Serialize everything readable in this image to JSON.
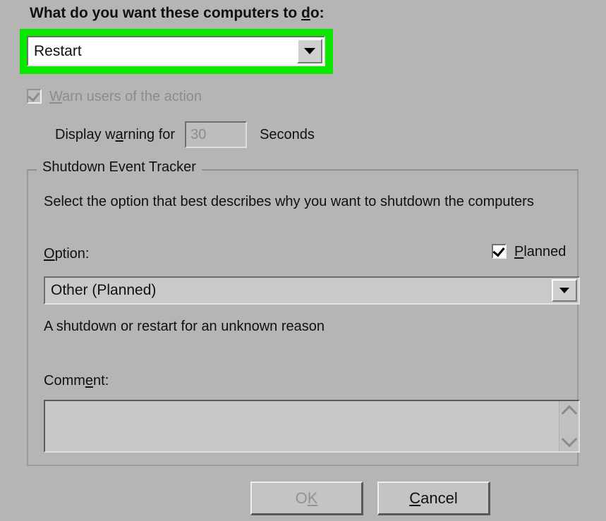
{
  "dialog": {
    "background_color": "#b5b5b5",
    "question_label_prefix": "What do you want these computers to ",
    "question_label_accel": "d",
    "question_label_suffix": "o:"
  },
  "action": {
    "highlight_color": "#0be800",
    "selected_value": "Restart",
    "dropdown_icon": "chevron-down-icon"
  },
  "warn": {
    "checked": true,
    "enabled": false,
    "label_accel": "W",
    "label_rest": "arn users of the action",
    "display_warning_prefix": "Display w",
    "display_warning_accel": "a",
    "display_warning_suffix": "rning for",
    "seconds_value": "30",
    "seconds_label": "Seconds"
  },
  "tracker": {
    "legend": "Shutdown Event Tracker",
    "description": "Select the option that best describes why you want to shutdown the computers",
    "option_label_accel": "O",
    "option_label_rest": "ption:",
    "planned_label_accel": "P",
    "planned_label_rest": "lanned",
    "planned_checked": true,
    "option_selected": "Other (Planned)",
    "option_dropdown_icon": "chevron-down-icon",
    "option_description": "A shutdown or restart for an unknown reason",
    "comment_label_prefix": "Comm",
    "comment_label_accel": "e",
    "comment_label_suffix": "nt:",
    "comment_value": "",
    "scroll_up_icon": "chevron-up-icon",
    "scroll_down_icon": "chevron-down-icon"
  },
  "buttons": {
    "ok_prefix": "O",
    "ok_accel": "K",
    "ok_enabled": false,
    "cancel_accel": "C",
    "cancel_rest": "ancel",
    "cancel_enabled": true
  }
}
